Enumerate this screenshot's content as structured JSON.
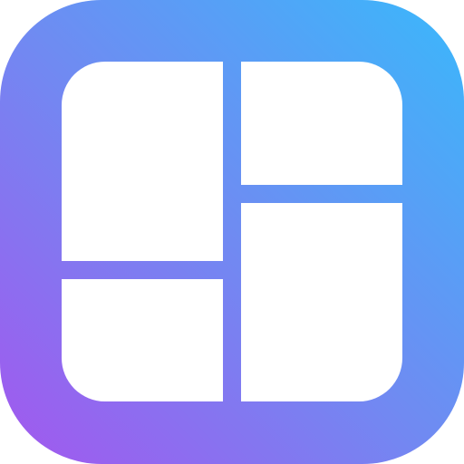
{
  "icon": {
    "name": "collage-grid-icon",
    "gradient": {
      "start_color": "#A357EE",
      "mid_color": "#6F8BF2",
      "end_color": "#3AB8FB"
    },
    "tile_color": "#FFFFFF",
    "tile_count": 4
  }
}
